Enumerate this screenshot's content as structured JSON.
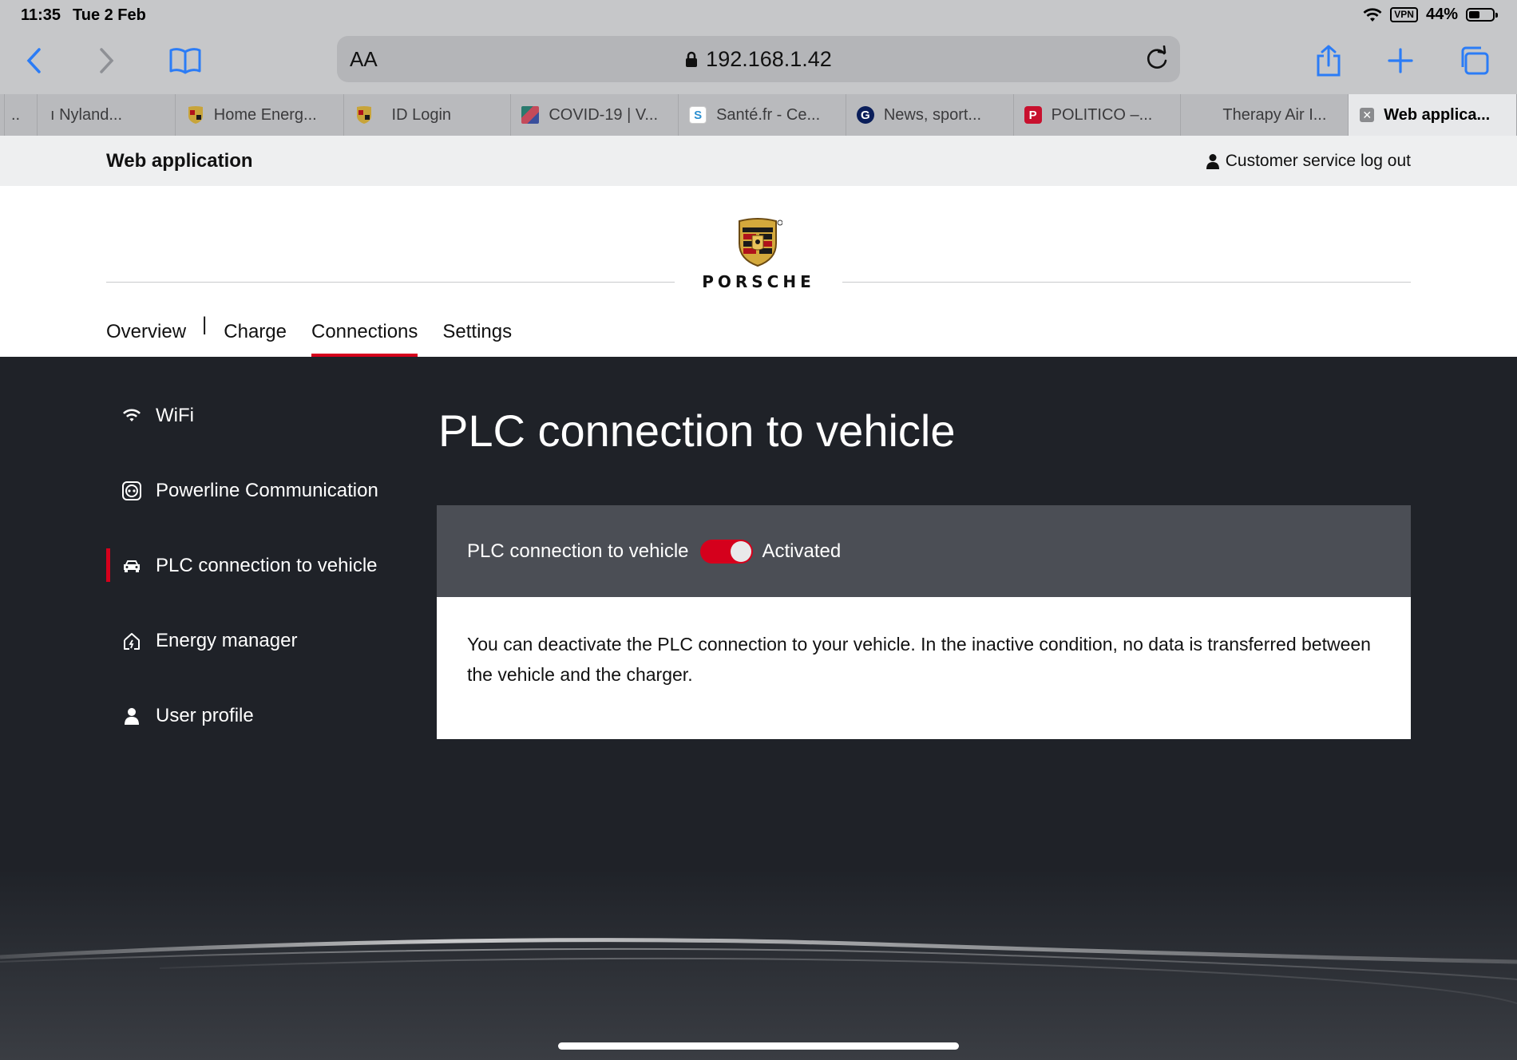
{
  "status_bar": {
    "time": "11:35",
    "date": "Tue 2 Feb",
    "battery": "44%",
    "vpn": "VPN"
  },
  "browser": {
    "text_size_label": "AA",
    "url": "192.168.1.42",
    "tabs": [
      {
        "label": "..",
        "favicon": ""
      },
      {
        "label": "ı Nyland...",
        "favicon": ""
      },
      {
        "label": "Home Energ...",
        "favicon": "porsche-crest"
      },
      {
        "label": "ID Login",
        "favicon": "porsche-crest"
      },
      {
        "label": "COVID-19 | V...",
        "favicon": "colored-squares"
      },
      {
        "label": "Santé.fr - Ce...",
        "favicon": "S"
      },
      {
        "label": "News, sport...",
        "favicon": "G"
      },
      {
        "label": "POLITICO –...",
        "favicon": "P"
      },
      {
        "label": "Therapy Air I...",
        "favicon": ""
      },
      {
        "label": "Web applica...",
        "favicon": "close"
      }
    ]
  },
  "app": {
    "title": "Web application",
    "logout_label": "Customer service log out",
    "brand": "PORSCHE",
    "nav": {
      "overview": "Overview",
      "separator": "|",
      "charge": "Charge",
      "connections": "Connections",
      "settings": "Settings"
    },
    "sidebar": [
      {
        "label": "WiFi",
        "icon": "wifi-icon"
      },
      {
        "label": "Powerline Communication",
        "icon": "plug-icon"
      },
      {
        "label": "PLC connection to vehicle",
        "icon": "car-icon",
        "active": true
      },
      {
        "label": "Energy manager",
        "icon": "house-icon"
      },
      {
        "label": "User profile",
        "icon": "user-icon"
      }
    ],
    "heading": "PLC connection to vehicle",
    "setting": {
      "label": "PLC connection to vehicle",
      "state": "Activated",
      "enabled": true
    },
    "description": "You can deactivate the PLC connection to your vehicle. In the inactive condition, no data is transferred between the vehicle and the charger."
  },
  "colors": {
    "accent": "#d5001c",
    "dark_bg": "#1f2228",
    "panel": "#4b4e55"
  }
}
